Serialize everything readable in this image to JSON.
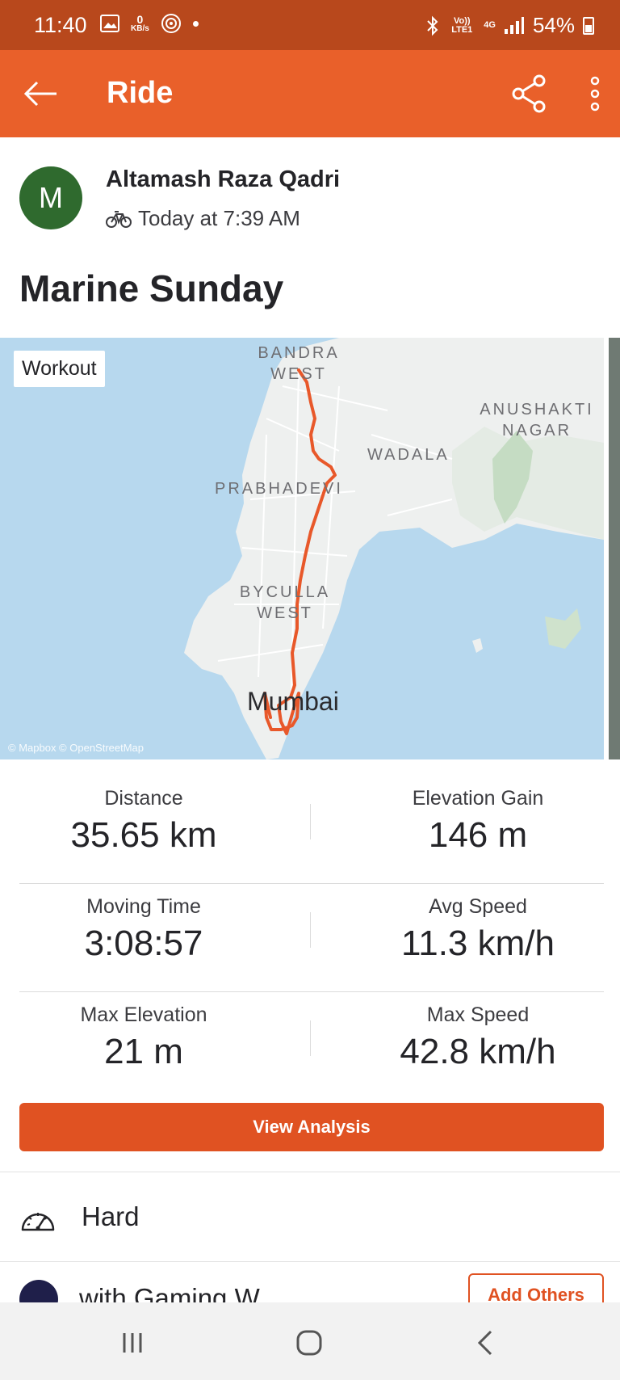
{
  "status_bar": {
    "time": "11:40",
    "net_speed": "0",
    "net_speed_unit": "KB/s",
    "volte": "Vo)) LTE1",
    "network": "4G",
    "battery": "54%"
  },
  "app_bar": {
    "title": "Ride",
    "back_icon": "arrow-left-icon",
    "share_icon": "share-icon",
    "more_icon": "more-vertical-icon"
  },
  "athlete": {
    "initial": "M",
    "name": "Altamash Raza Qadri",
    "timestamp": "Today at 7:39 AM",
    "activity_icon": "bike-icon"
  },
  "activity": {
    "title": "Marine Sunday"
  },
  "map": {
    "badge": "Workout",
    "attribution": "© Mapbox © OpenStreetMap",
    "labels": {
      "bandra": "BANDRA WEST",
      "anushakti": "ANUSHAKTI NAGAR",
      "wadala": "WADALA",
      "prabhadevi": "PRABHADEVI",
      "byculla": "BYCULLA WEST",
      "mumbai": "Mumbai"
    },
    "route_color": "#e8582a",
    "water_color": "#b7d8ee",
    "land_color": "#eef0ef"
  },
  "stats": [
    {
      "label": "Distance",
      "value": "35.65 km"
    },
    {
      "label": "Elevation Gain",
      "value": "146 m"
    },
    {
      "label": "Moving Time",
      "value": "3:08:57"
    },
    {
      "label": "Avg Speed",
      "value": "11.3 km/h"
    },
    {
      "label": "Max Elevation",
      "value": "21 m"
    },
    {
      "label": "Max Speed",
      "value": "42.8 km/h"
    }
  ],
  "actions": {
    "view_analysis": "View Analysis",
    "add_others": "Add Others"
  },
  "effort": {
    "icon": "gauge-icon",
    "label": "Hard"
  },
  "with": {
    "text": "with Gaming W"
  },
  "nav_bar": {
    "recents_icon": "recents-icon",
    "home_icon": "home-icon",
    "back_icon": "nav-back-icon"
  },
  "colors": {
    "brand": "#e9602a",
    "status_bar": "#b8481c",
    "button": "#e05222"
  }
}
